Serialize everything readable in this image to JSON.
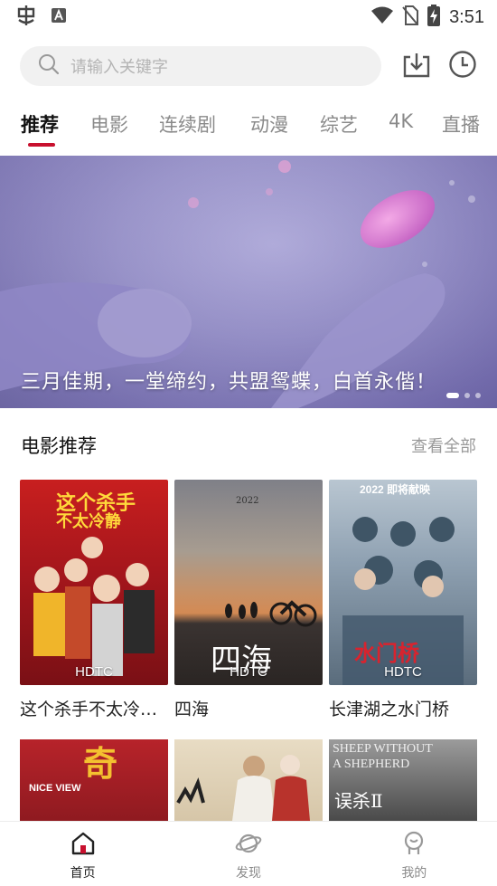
{
  "status_bar": {
    "time": "3:51",
    "left_icons": [
      "app-notification-icon",
      "a-notification-icon"
    ],
    "right_icons": [
      "wifi-icon",
      "no-sim-icon",
      "battery-charging-icon"
    ]
  },
  "search": {
    "placeholder": "请输入关键字",
    "icons": [
      "search-icon",
      "download-icon",
      "history-icon"
    ]
  },
  "tabs": [
    {
      "label": "推荐",
      "active": true
    },
    {
      "label": "电影",
      "active": false
    },
    {
      "label": "连续剧",
      "active": false
    },
    {
      "label": "动漫",
      "active": false
    },
    {
      "label": "综艺",
      "active": false
    },
    {
      "label": "4K",
      "active": false
    },
    {
      "label": "直播",
      "active": false
    }
  ],
  "banner": {
    "caption": "三月佳期，一堂缔约，共盟鸳蝶，白首永偕！",
    "slide_count": 3,
    "active_slide": 0
  },
  "section": {
    "title": "电影推荐",
    "more": "查看全部"
  },
  "movies": [
    {
      "title": "这个杀手不太冷…",
      "quality": "HDTC",
      "poster_text_a": "这个杀手",
      "poster_text_b": "不太冷静"
    },
    {
      "title": "四海",
      "quality": "HDTC",
      "poster_text_a": "2022",
      "poster_text_b": "四海"
    },
    {
      "title": "长津湖之水门桥",
      "quality": "HDTC",
      "poster_text_a": "2022 即将献映",
      "poster_text_b": "水门桥"
    }
  ],
  "movies_row2": [
    {
      "poster_text_a": "奇",
      "poster_text_b": "NICE VIEW"
    },
    {
      "poster_text_a": "",
      "poster_text_b": ""
    },
    {
      "poster_text_a": "SHEEP WITHOUT A SHEPHERD",
      "poster_text_b": "误杀Ⅱ"
    }
  ],
  "bottom_nav": [
    {
      "label": "首页",
      "icon": "home-icon",
      "active": true
    },
    {
      "label": "发现",
      "icon": "planet-icon",
      "active": false
    },
    {
      "label": "我的",
      "icon": "profile-icon",
      "active": false
    }
  ],
  "colors": {
    "accent": "#c8102e",
    "tab_inactive": "#8a8a8a",
    "search_bg": "#f1f1f1"
  }
}
